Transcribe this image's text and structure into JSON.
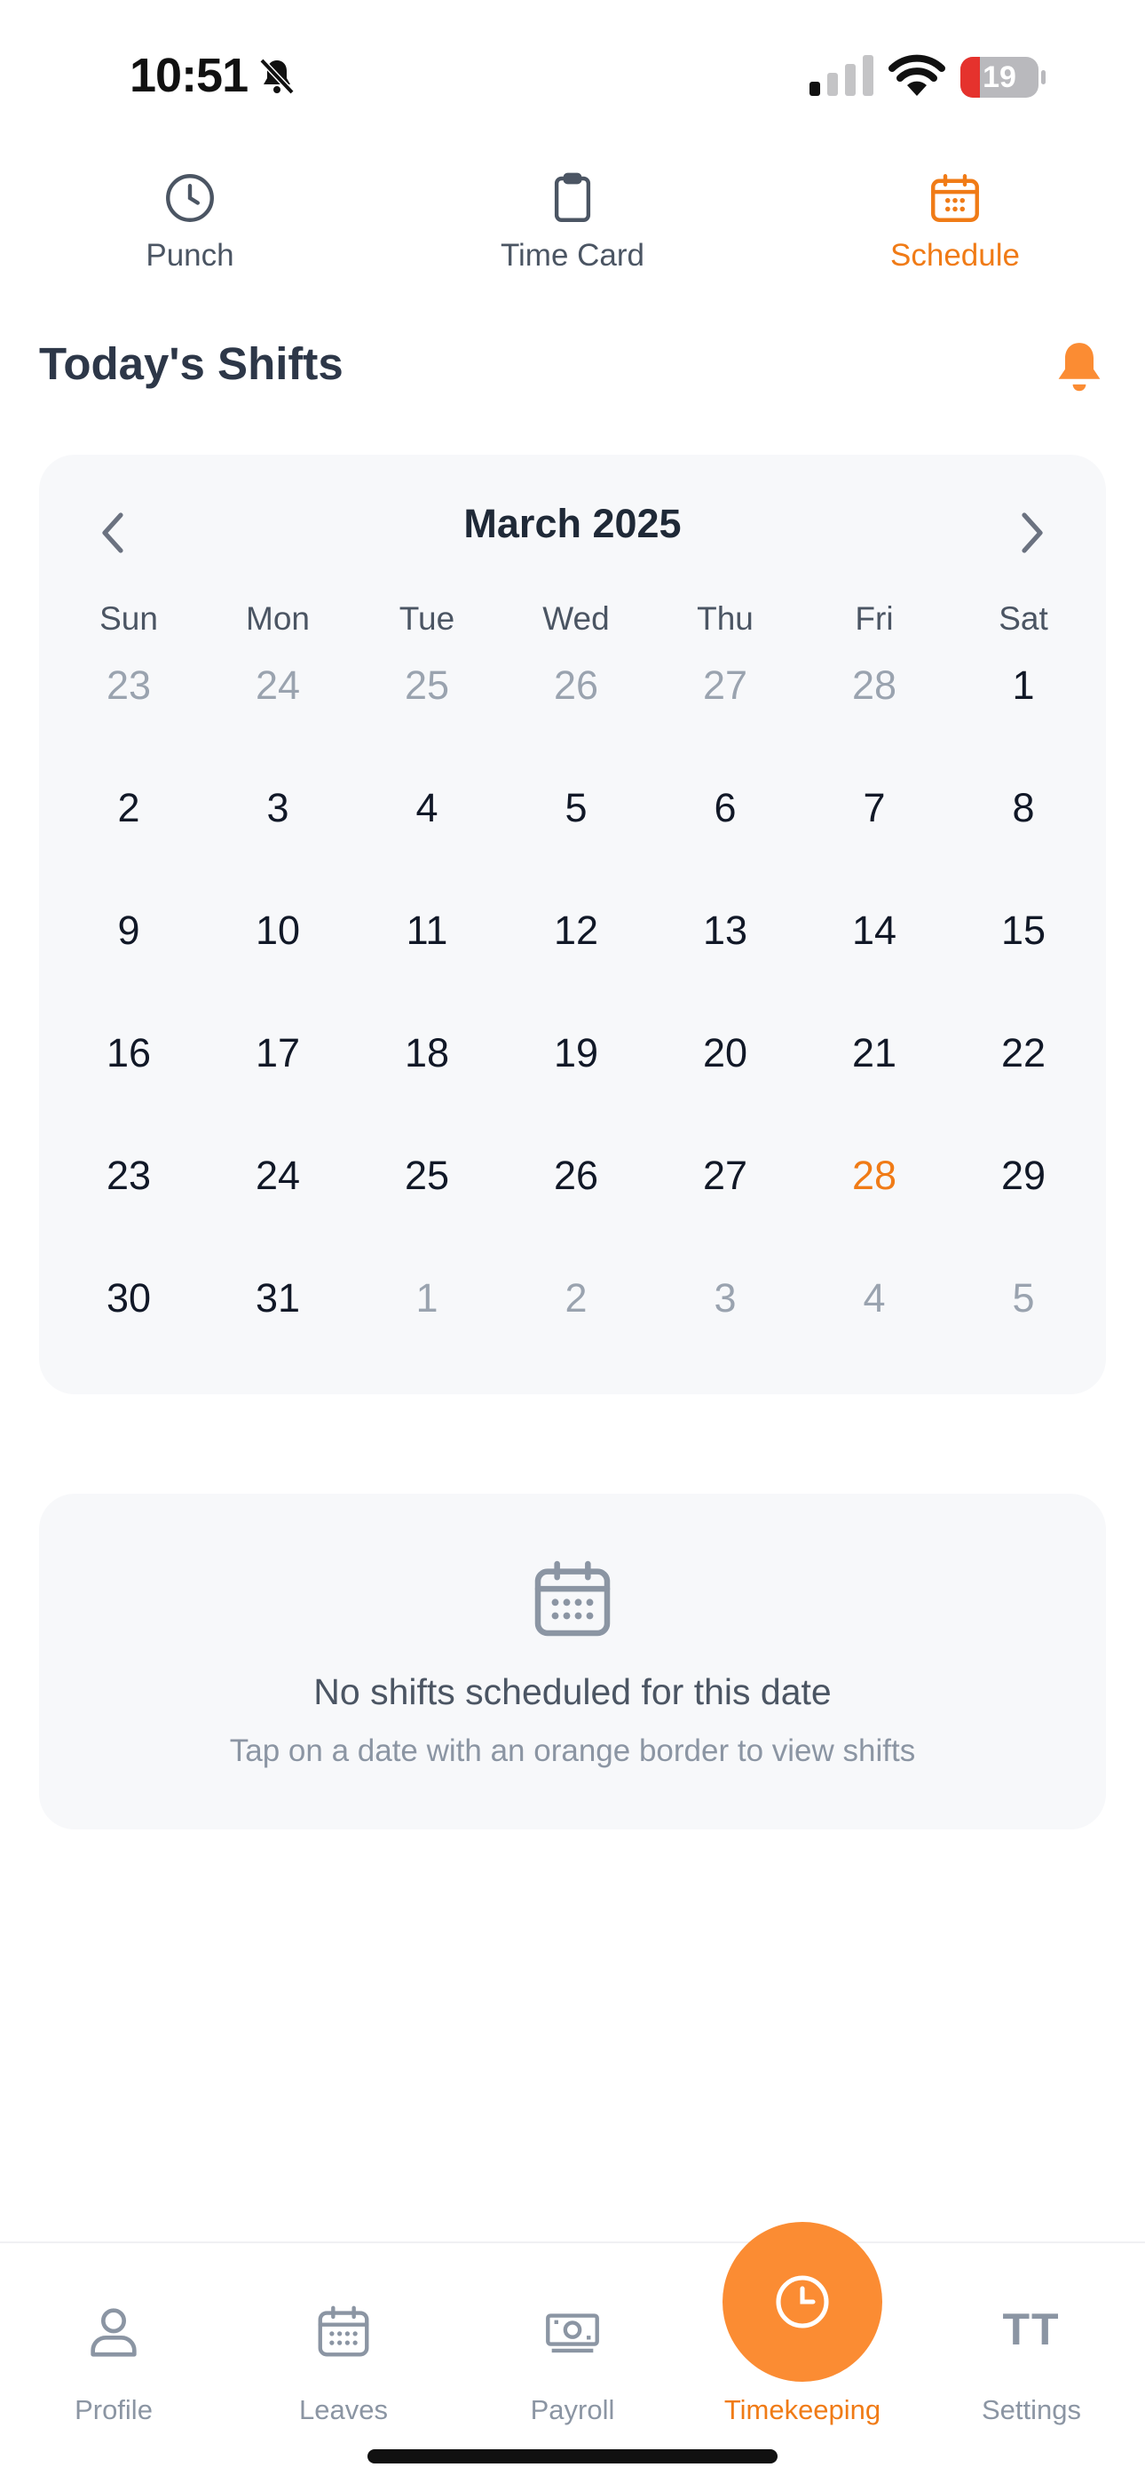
{
  "status_bar": {
    "time": "10:51",
    "battery": "19"
  },
  "top_tabs": [
    {
      "label": "Punch",
      "icon": "clock-icon"
    },
    {
      "label": "Time Card",
      "icon": "clipboard-icon"
    },
    {
      "label": "Schedule",
      "icon": "calendar-icon",
      "active": true
    }
  ],
  "header": {
    "title": "Today's Shifts"
  },
  "calendar": {
    "month": "March 2025",
    "weekdays": [
      "Sun",
      "Mon",
      "Tue",
      "Wed",
      "Thu",
      "Fri",
      "Sat"
    ],
    "days": [
      {
        "n": "23",
        "s": "muted"
      },
      {
        "n": "24",
        "s": "muted"
      },
      {
        "n": "25",
        "s": "muted"
      },
      {
        "n": "26",
        "s": "muted"
      },
      {
        "n": "27",
        "s": "muted"
      },
      {
        "n": "28",
        "s": "muted"
      },
      {
        "n": "1",
        "s": ""
      },
      {
        "n": "2",
        "s": ""
      },
      {
        "n": "3",
        "s": ""
      },
      {
        "n": "4",
        "s": ""
      },
      {
        "n": "5",
        "s": ""
      },
      {
        "n": "6",
        "s": ""
      },
      {
        "n": "7",
        "s": ""
      },
      {
        "n": "8",
        "s": ""
      },
      {
        "n": "9",
        "s": ""
      },
      {
        "n": "10",
        "s": ""
      },
      {
        "n": "11",
        "s": ""
      },
      {
        "n": "12",
        "s": ""
      },
      {
        "n": "13",
        "s": ""
      },
      {
        "n": "14",
        "s": ""
      },
      {
        "n": "15",
        "s": ""
      },
      {
        "n": "16",
        "s": ""
      },
      {
        "n": "17",
        "s": ""
      },
      {
        "n": "18",
        "s": ""
      },
      {
        "n": "19",
        "s": ""
      },
      {
        "n": "20",
        "s": ""
      },
      {
        "n": "21",
        "s": ""
      },
      {
        "n": "22",
        "s": ""
      },
      {
        "n": "23",
        "s": ""
      },
      {
        "n": "24",
        "s": ""
      },
      {
        "n": "25",
        "s": ""
      },
      {
        "n": "26",
        "s": ""
      },
      {
        "n": "27",
        "s": ""
      },
      {
        "n": "28",
        "s": "today"
      },
      {
        "n": "29",
        "s": ""
      },
      {
        "n": "30",
        "s": ""
      },
      {
        "n": "31",
        "s": ""
      },
      {
        "n": "1",
        "s": "muted"
      },
      {
        "n": "2",
        "s": "muted"
      },
      {
        "n": "3",
        "s": "muted"
      },
      {
        "n": "4",
        "s": "muted"
      },
      {
        "n": "5",
        "s": "muted"
      }
    ]
  },
  "empty_state": {
    "title": "No shifts scheduled for this date",
    "subtitle": "Tap on a date with an orange border to view shifts"
  },
  "bottom_nav": [
    {
      "label": "Profile",
      "icon": "person-icon"
    },
    {
      "label": "Leaves",
      "icon": "calendar-icon"
    },
    {
      "label": "Payroll",
      "icon": "money-icon"
    },
    {
      "label": "Timekeeping",
      "icon": "clock-icon",
      "active": true
    },
    {
      "label": "Settings",
      "icon": "initials-avatar",
      "initials": "TT"
    }
  ],
  "colors": {
    "accent": "#f07b16",
    "fab": "#fb8c33",
    "text": "#1f2937",
    "muted": "#9aa3af",
    "card": "#f7f8fa"
  }
}
